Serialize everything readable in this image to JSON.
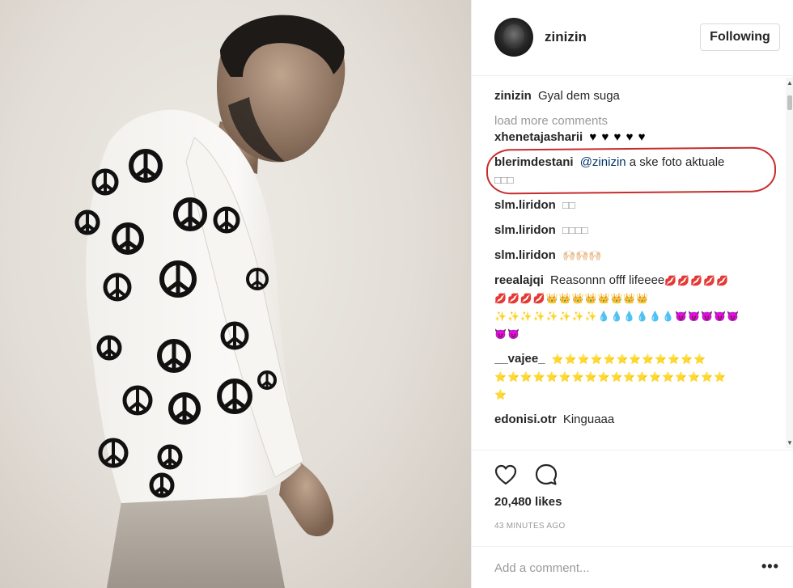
{
  "post": {
    "image_alt": "Man in white peace-sign sweatshirt looking down"
  },
  "header": {
    "username": "zinizin",
    "follow_label": "Following"
  },
  "caption": {
    "user": "zinizin",
    "text": "Gyal dem suga"
  },
  "load_more_label": "load more comments",
  "comments": [
    {
      "user": "xhenetajasharii",
      "text": "♥ ♥ ♥ ♥ ♥"
    },
    {
      "user": "blerimdestani",
      "mention": "@zinizin",
      "text": "a ske foto aktuale",
      "text2": "□□□"
    },
    {
      "user": "slm.liridon",
      "text": "□□"
    },
    {
      "user": "slm.liridon",
      "text": "□□□□"
    },
    {
      "user": "slm.liridon",
      "text": "🙌🏻🙌🏻🙌🏻"
    },
    {
      "user": "reealajqi",
      "text": "Reasonnn offf lifeeee",
      "emoji1": "💋💋💋💋💋",
      "emoji2": "💋💋💋💋",
      "emoji3": "👑👑👑👑👑👑👑👑",
      "emoji4": "✨✨✨✨✨✨✨✨",
      "emoji5": "💧💧💧💧💧💧",
      "emoji6": "😈😈😈😈😈",
      "emoji7": "😈😈"
    },
    {
      "user": "__vajee_",
      "stars1": "⭐⭐⭐⭐⭐⭐⭐⭐⭐⭐⭐⭐",
      "stars2": "⭐⭐⭐⭐⭐⭐⭐⭐⭐⭐⭐⭐⭐⭐⭐⭐⭐⭐",
      "stars3": "⭐"
    },
    {
      "user": "edonisi.otr",
      "text": "Kinguaaa"
    }
  ],
  "actions": {
    "like_icon": "heart-outline-icon",
    "comment_icon": "comment-bubble-icon"
  },
  "likes_label": "20,480 likes",
  "timestamp": "43 MINUTES AGO",
  "add_comment": {
    "placeholder": "Add a comment...",
    "more_label": "•••"
  },
  "colors": {
    "highlight": "#c72c2c",
    "mention": "#003569",
    "muted": "#999999"
  }
}
